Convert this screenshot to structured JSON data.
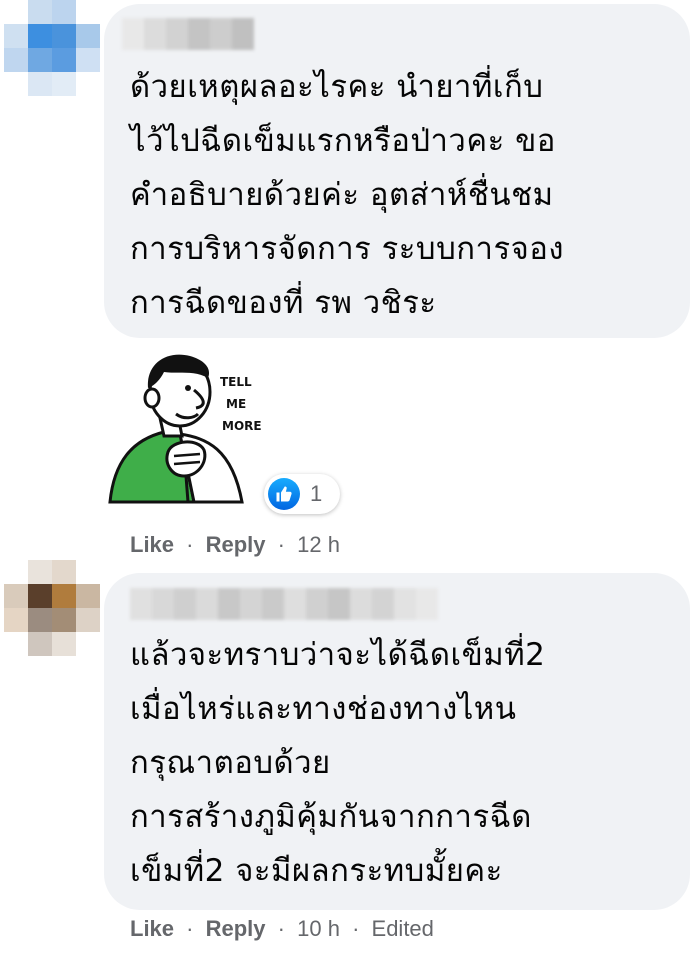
{
  "comments": [
    {
      "text_lines": [
        "ด้วยเหตุผลอะไรคะ นำยาที่เก็บ",
        "ไว้ไปฉีดเข็มแรกหรือป่าวคะ ขอ",
        "คำอธิบายด้วยค่ะ อุตส่าห์ชื่นชม",
        "การบริหารจัดการ ระบบการจอง",
        "การฉีดของที่ รพ วชิระ"
      ],
      "sticker_text": [
        "TELL",
        "ME",
        "MORE"
      ],
      "reaction_count": "1",
      "like_label": "Like",
      "reply_label": "Reply",
      "time": "12 h",
      "edited": ""
    },
    {
      "text_lines": [
        "แล้วจะทราบว่าจะได้ฉีดเข็มที่2",
        "เมื่อไหร่และทางช่องทางไหน",
        "กรุณาตอบด้วย",
        "การสร้างภูมิคุ้มกันจากการฉีด",
        "เข็มที่2 จะมีผลกระทบมั้ยคะ"
      ],
      "like_label": "Like",
      "reply_label": "Reply",
      "time": "10 h",
      "edited": "Edited"
    }
  ],
  "separator": "·",
  "colors": {
    "bubble": "#f0f2f5",
    "meta": "#65676b",
    "like_blue": "#0866ff",
    "sticker_green": "#3fae49"
  },
  "icons": {
    "reaction": "like-thumb-icon",
    "avatar1": "blurred-avatar",
    "avatar2": "blurred-avatar"
  }
}
